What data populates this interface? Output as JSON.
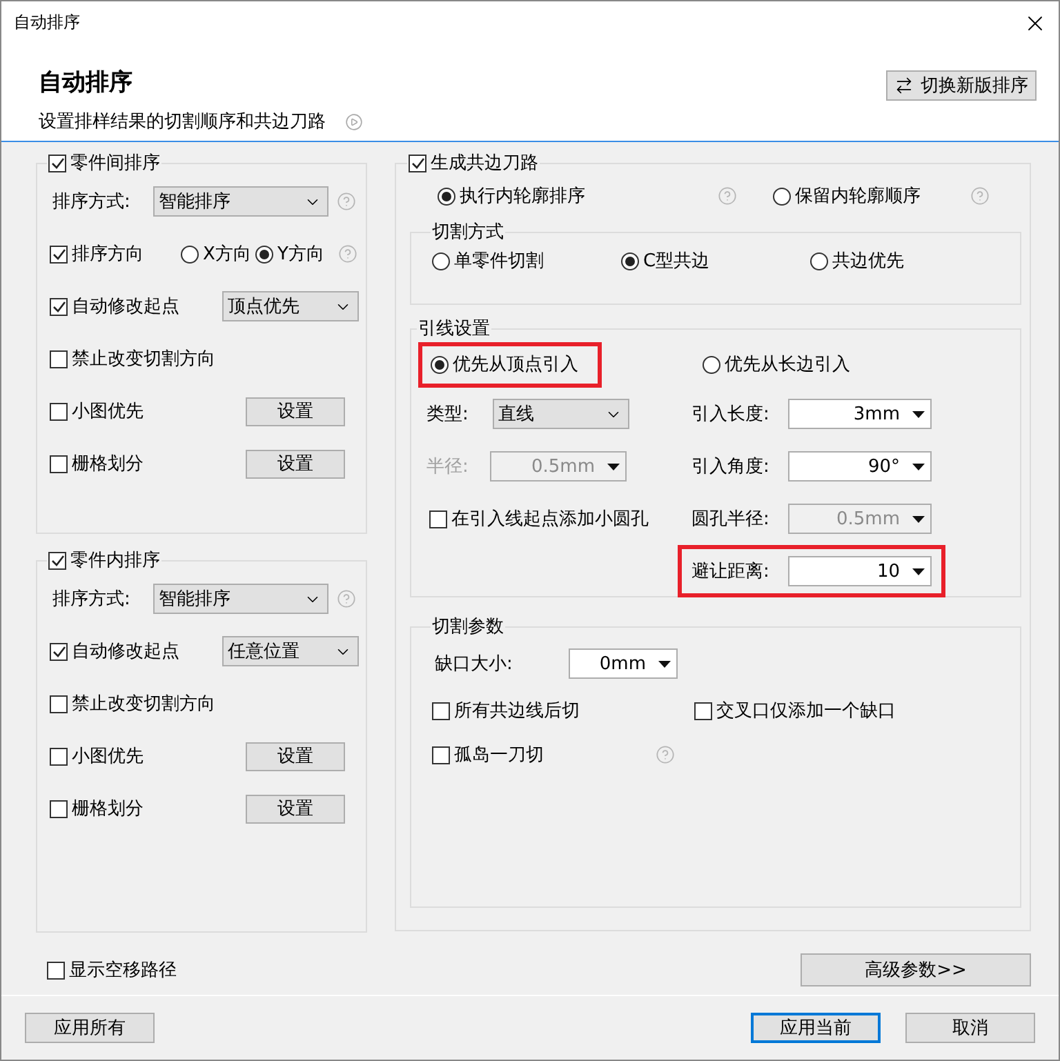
{
  "window": {
    "title": "自动排序"
  },
  "header": {
    "title": "自动排序",
    "subtitle": "设置排样结果的切割顺序和共边刀路",
    "switch_button": "切换新版排序"
  },
  "left_groups": [
    {
      "title": "零件间排序",
      "checked": true,
      "rows": [
        {
          "kind": "select",
          "label": "排序方式:",
          "value": "智能排序",
          "help": true
        },
        {
          "kind": "direction",
          "label": "排序方向",
          "checked": true,
          "options": [
            {
              "label": "X方向",
              "selected": false
            },
            {
              "label": "Y方向",
              "selected": true
            }
          ],
          "help": true
        },
        {
          "kind": "check_select",
          "label": "自动修改起点",
          "checked": true,
          "value": "顶点优先"
        },
        {
          "kind": "check",
          "label": "禁止改变切割方向",
          "checked": false
        },
        {
          "kind": "check_button",
          "label": "小图优先",
          "checked": false,
          "button": "设置"
        },
        {
          "kind": "check_button",
          "label": "栅格划分",
          "checked": false,
          "button": "设置"
        }
      ]
    },
    {
      "title": "零件内排序",
      "checked": true,
      "rows": [
        {
          "kind": "select",
          "label": "排序方式:",
          "value": "智能排序",
          "help": true
        },
        {
          "kind": "check_select",
          "label": "自动修改起点",
          "checked": true,
          "value": "任意位置"
        },
        {
          "kind": "check",
          "label": "禁止改变切割方向",
          "checked": false
        },
        {
          "kind": "check_button",
          "label": "小图优先",
          "checked": false,
          "button": "设置"
        },
        {
          "kind": "check_button",
          "label": "栅格划分",
          "checked": false,
          "button": "设置"
        }
      ]
    }
  ],
  "show_path": {
    "label": "显示空移路径",
    "checked": false
  },
  "right_group": {
    "title": "生成共边刀路",
    "checked": true,
    "order_options": [
      {
        "label": "执行内轮廓排序",
        "selected": true,
        "help": true
      },
      {
        "label": "保留内轮廓顺序",
        "selected": false,
        "help": true
      }
    ],
    "cut_mode": {
      "title": "切割方式",
      "options": [
        {
          "label": "单零件切割",
          "selected": false
        },
        {
          "label": "C型共边",
          "selected": true
        },
        {
          "label": "共边优先",
          "selected": false
        }
      ]
    },
    "lead": {
      "title": "引线设置",
      "options": [
        {
          "label": "优先从顶点引入",
          "selected": true,
          "highlighted": true
        },
        {
          "label": "优先从长边引入",
          "selected": false,
          "highlighted": false
        }
      ],
      "left": [
        {
          "kind": "select",
          "label": "类型:",
          "value": "直线",
          "label_disabled": false
        },
        {
          "kind": "combo",
          "label": "半径:",
          "value": "0.5mm",
          "disabled": true,
          "label_disabled": true
        },
        {
          "kind": "check",
          "label": "在引入线起点添加小圆孔",
          "checked": false
        }
      ],
      "right": [
        {
          "label": "引入长度:",
          "value": "3mm",
          "disabled": false,
          "highlighted": false
        },
        {
          "label": "引入角度:",
          "value": "90°",
          "disabled": false,
          "highlighted": false
        },
        {
          "label": "圆孔半径:",
          "value": "0.5mm",
          "disabled": true,
          "highlighted": false
        },
        {
          "label": "避让距离:",
          "value": "10",
          "disabled": false,
          "highlighted": true
        }
      ]
    },
    "params": {
      "title": "切割参数",
      "gap": {
        "label": "缺口大小:",
        "value": "0mm"
      },
      "checks": [
        {
          "label": "所有共边线后切",
          "checked": false,
          "help": false
        },
        {
          "label": "交叉口仅添加一个缺口",
          "checked": false,
          "help": false
        },
        {
          "label": "孤岛一刀切",
          "checked": false,
          "help": true
        }
      ]
    }
  },
  "advanced_button": "高级参数>>",
  "buttons": [
    {
      "label": "应用所有",
      "kind": "left",
      "primary": false
    },
    {
      "label": "应用当前",
      "kind": "right",
      "primary": true
    },
    {
      "label": "取消",
      "kind": "right",
      "primary": false
    }
  ]
}
